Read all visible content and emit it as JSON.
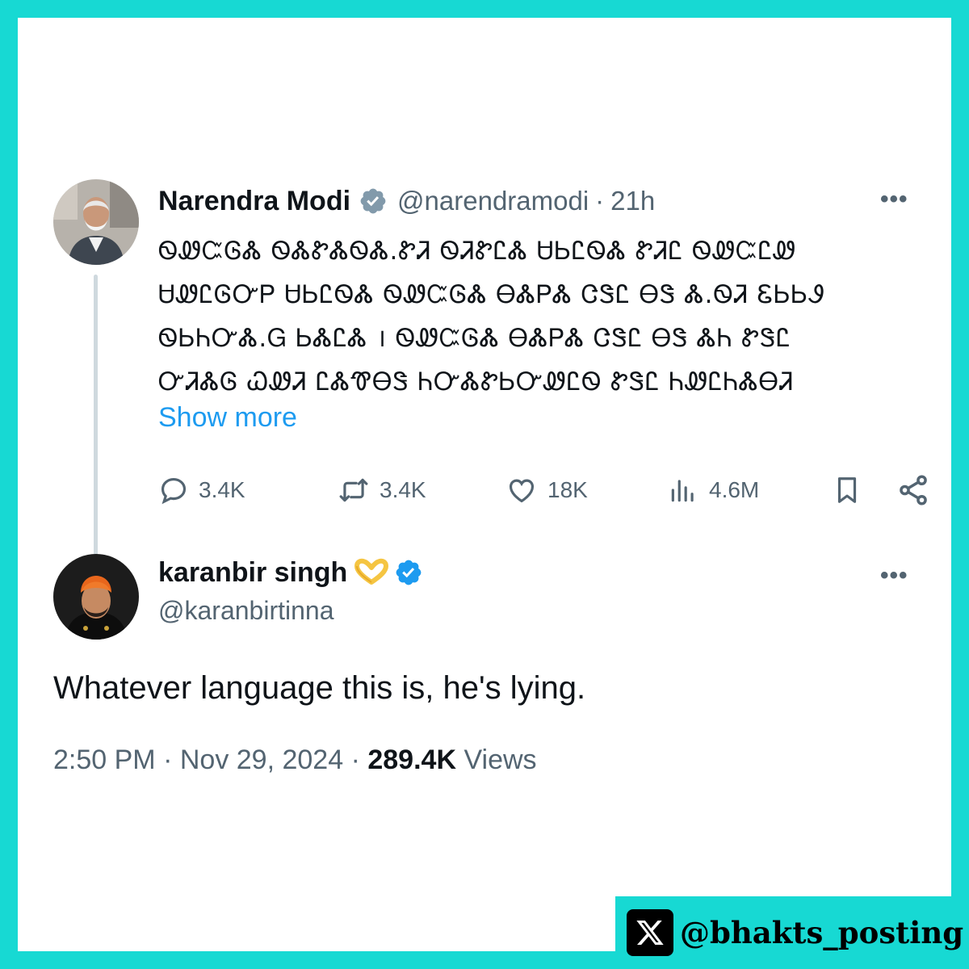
{
  "original_tweet": {
    "display_name": "Narendra Modi",
    "handle": "@narendramodi",
    "separator": "·",
    "time": "21h",
    "more_icon": "more-horizontal-icon",
    "body_lines": [
      "ᏫᏪᏨᎶᏜ ᏫᏜᏑᏜᏫᏜ.ᏑᏘ ᏫᏘᏑᏝᏜ ᏌᏏᏝᏫᏜ ᏑᏘᏝ ᏫᏪᏨᏝᏪ",
      "ᏌᏪᏝᎶᏅᏢ ᏌᏏᏝᏫᏜ ᏫᏪᏨᎶᏜ ᎾᏜᏢᏜ ᏣᏕᏝ ᎾᏕ Ꮬ.ᏫᏘ ᏋᏏᏏᏭ",
      "ᏫᏏᏂᏅᏜ.Ꮐ ᏏᏜᏝᏜ । ᏫᏪᏨᎶᏜ ᎾᏜᏢᏜ ᏣᏕᏝ ᎾᏕ ᏜᏂ ᏑᏕᏝ",
      "ᏅᏘᏜᎶ ᏇᏪᏘ ᏝᏜᏡᎾᏕ ᏂᏅᏜᏑᏏᏅᏪᏝᏫ ᏑᏕᏝ ᏂᏪᏝᏂᏜᎾᏘ"
    ],
    "show_more": "Show more",
    "stats": {
      "replies": "3.4K",
      "reposts": "3.4K",
      "likes": "18K",
      "views": "4.6M"
    },
    "icons": [
      "reply-icon",
      "repost-icon",
      "like-icon",
      "views-icon",
      "bookmark-icon",
      "share-icon"
    ]
  },
  "reply_tweet": {
    "display_name": "karanbir singh",
    "emoji": "heart-hands-emoji",
    "handle": "@karanbirtinna",
    "text": "Whatever language this is, he's lying.",
    "time": "2:50 PM",
    "date": "Nov 29, 2024",
    "separator": "·",
    "views_count": "289.4K",
    "views_label": "Views"
  },
  "watermark": {
    "text": "@bhakts_posting",
    "logo": "x-logo-icon"
  },
  "colors": {
    "frame": "#17d9d3",
    "card": "#ffffff",
    "text_primary": "#0f1419",
    "text_secondary": "#536471",
    "link": "#1d9bf0",
    "verified_blue": "#1d9bf0",
    "verified_grey": "#829aab",
    "thread_line": "#cfd9de"
  }
}
